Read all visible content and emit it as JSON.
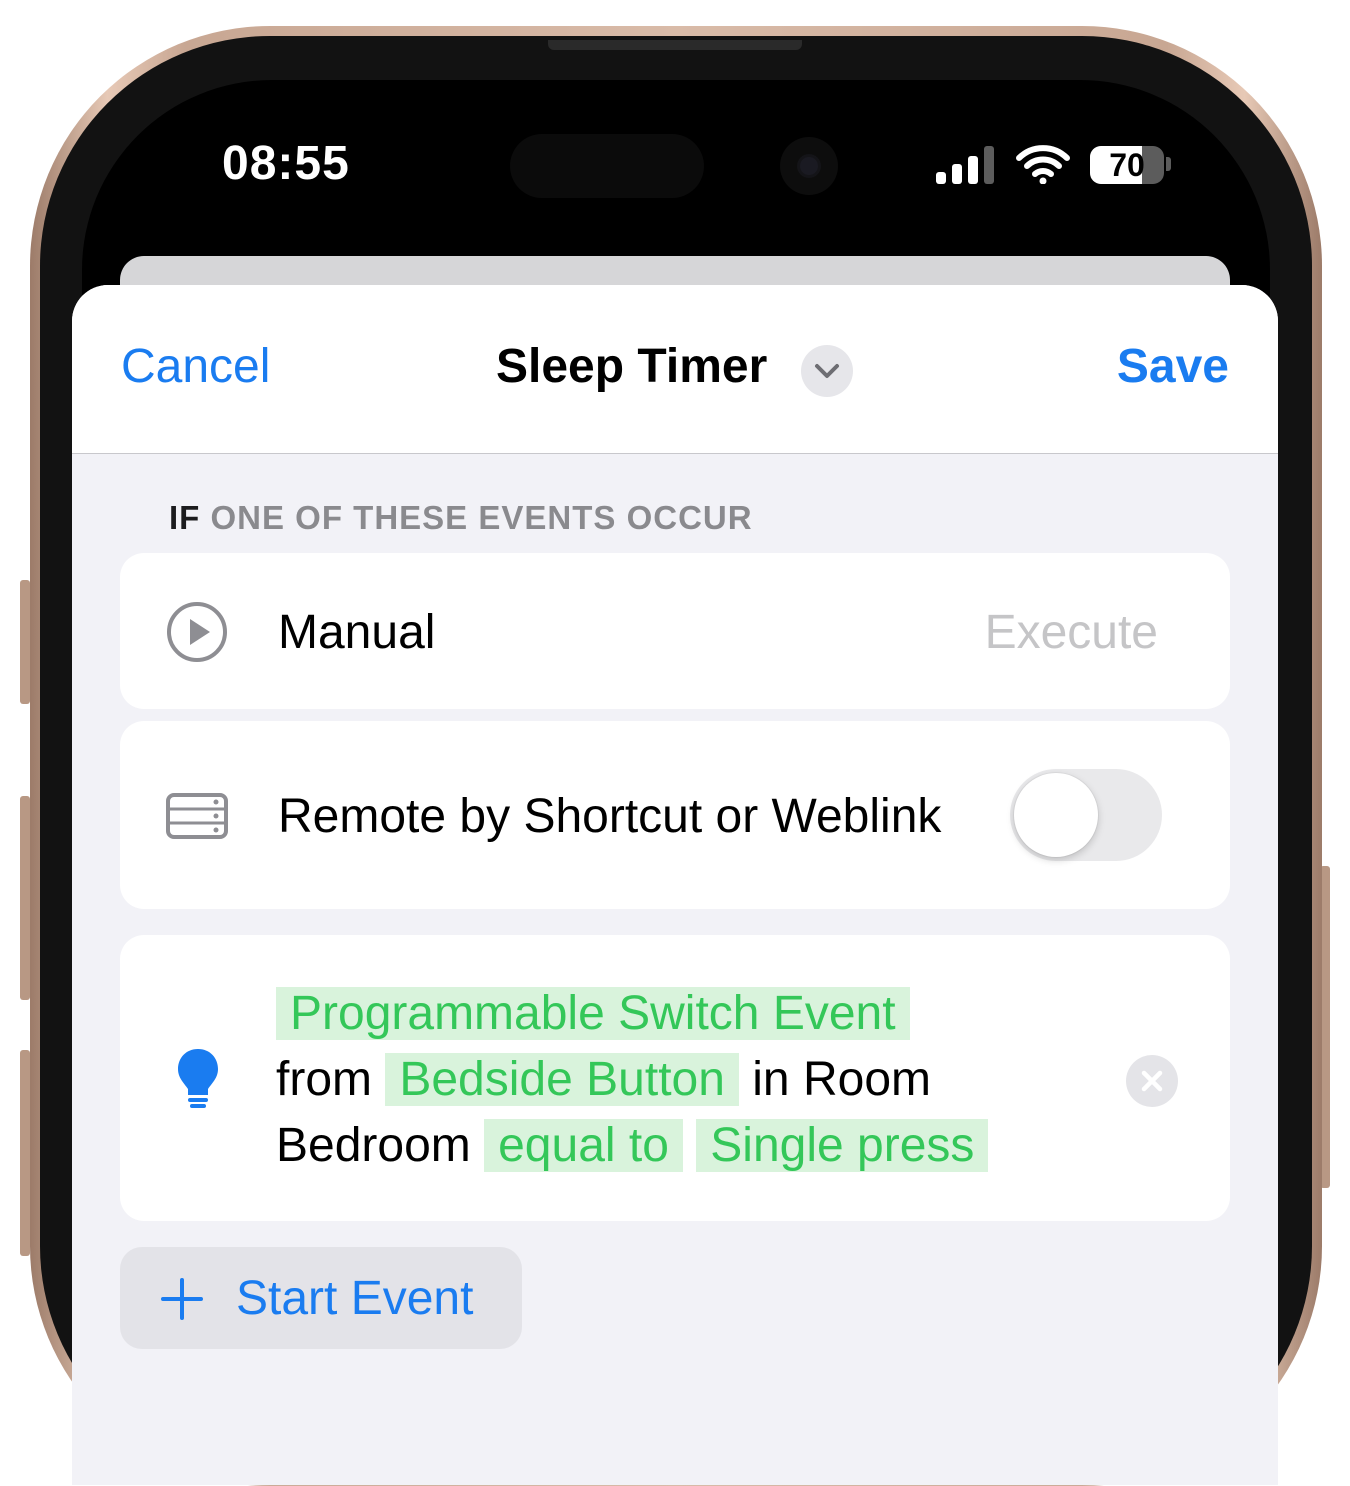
{
  "status_bar": {
    "time": "08:55",
    "battery_level": "70",
    "battery_percent": 70
  },
  "nav": {
    "cancel_label": "Cancel",
    "title": "Sleep Timer",
    "save_label": "Save"
  },
  "section": {
    "if_prefix": "IF",
    "header_rest": "ONE OF THESE EVENTS OCCUR"
  },
  "manual_row": {
    "label": "Manual",
    "action": "Execute",
    "icon": "play-circle-icon"
  },
  "remote_row": {
    "label": "Remote by Shortcut or Weblink",
    "icon": "server-icon",
    "toggle_on": false
  },
  "switch_event": {
    "icon": "lightbulb-icon",
    "event_type": "Programmable Switch Event",
    "from_word": "from",
    "device": "Bedside Button",
    "in_room_word": "in Room",
    "room": "Bedroom",
    "comparator": "equal to",
    "value": "Single press"
  },
  "add_event": {
    "label": "Start Event",
    "icon": "plus-icon"
  },
  "colors": {
    "accent": "#1a7cf0",
    "pill_text": "#34c759",
    "pill_bg": "#d9f3dc",
    "sheet_bg": "#f2f2f7"
  }
}
